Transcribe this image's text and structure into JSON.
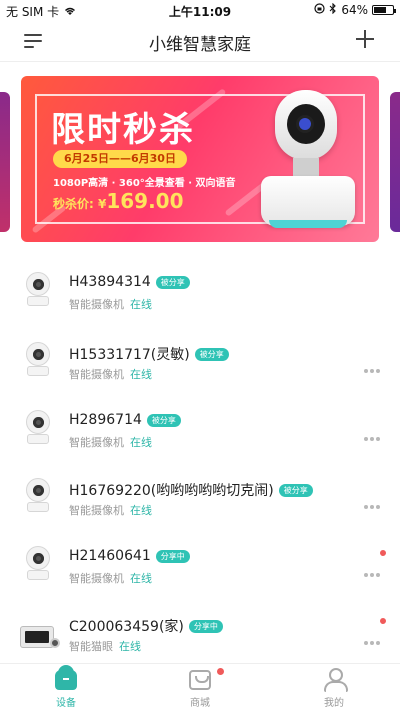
{
  "status_bar": {
    "carrier": "无 SIM 卡",
    "time": "上午11:09",
    "battery_percent": "64%",
    "battery_level": 0.64,
    "icons": [
      "wifi-icon",
      "orientation-lock-icon",
      "bluetooth-icon",
      "battery-icon"
    ]
  },
  "nav": {
    "title": "小维智慧家庭",
    "menu_icon": "menu-icon",
    "add_icon": "plus-icon"
  },
  "banner": {
    "headline": "限时秒杀",
    "dates": "6月25日——6月30日",
    "features": "1080P高清 · 360°全景查看 · 双向语音",
    "price_label": "秒杀价: ¥",
    "price_value": "169.00",
    "colors": {
      "start": "#ff5a3c",
      "end": "#ff7a98",
      "accent": "#ffd94a"
    }
  },
  "devices": [
    {
      "name": "H43894314",
      "badge": "被分享",
      "type": "智能摄像机",
      "status": "在线",
      "icon": "camera-icon",
      "has_more": false,
      "alert": false
    },
    {
      "name": "H15331717(灵敏)",
      "badge": "被分享",
      "type": "智能摄像机",
      "status": "在线",
      "icon": "camera-icon",
      "has_more": true,
      "alert": false
    },
    {
      "name": "H2896714",
      "badge": "被分享",
      "type": "智能摄像机",
      "status": "在线",
      "icon": "camera-icon",
      "has_more": true,
      "alert": false
    },
    {
      "name": "H16769220(哟哟哟哟哟切克闹)",
      "badge": "被分享",
      "type": "智能摄像机",
      "status": "在线",
      "icon": "camera-icon",
      "has_more": true,
      "alert": false
    },
    {
      "name": "H21460641",
      "badge": "分享中",
      "type": "智能摄像机",
      "status": "在线",
      "icon": "camera-icon",
      "has_more": true,
      "alert": true
    },
    {
      "name": "C200063459(家)",
      "badge": "分享中",
      "type": "智能猫眼",
      "status": "在线",
      "icon": "peephole-icon",
      "has_more": true,
      "alert": true
    }
  ],
  "tabbar": {
    "items": [
      {
        "label": "设备",
        "icon": "home-icon",
        "active": true
      },
      {
        "label": "商城",
        "icon": "shop-icon",
        "active": false,
        "dot": true
      },
      {
        "label": "我的",
        "icon": "profile-icon",
        "active": false
      }
    ],
    "active_color": "#2fb6a8",
    "inactive_color": "#999999"
  }
}
